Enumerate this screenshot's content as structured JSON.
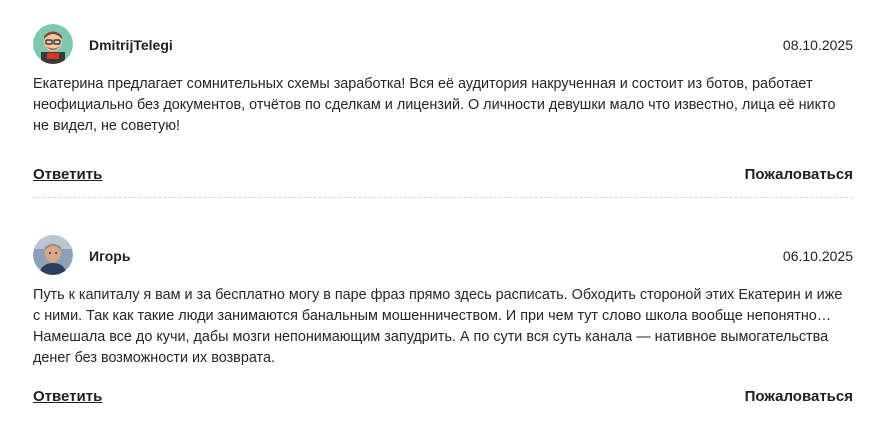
{
  "comments": [
    {
      "author": "DmitrijTelegi",
      "date": "08.10.2025",
      "text": "Екатерина предлагает сомнительных схемы заработка! Вся её аудитория накрученная и состоит из ботов, работает неофициально без документов, отчётов по сделкам и лицензий. О личности девушки мало что известно, лица её никто не видел, не советую!",
      "reply_label": "Ответить",
      "report_label": "Пожаловаться"
    },
    {
      "author": "Игорь",
      "date": "06.10.2025",
      "text": "Путь к капиталу я вам и за бесплатно могу в паре фраз прямо здесь расписать. Обходить стороной этих Екатерин и иже с ними. Так как такие люди занимаются банальным мошенничеством. И при чем тут слово школа вообще непонятно… Намешала все до кучи, дабы мозги непонимающим запудрить. А по сути вся суть канала — нативное вымогательства денег без возможности их возврата.",
      "reply_label": "Ответить",
      "report_label": "Пожаловаться"
    }
  ]
}
